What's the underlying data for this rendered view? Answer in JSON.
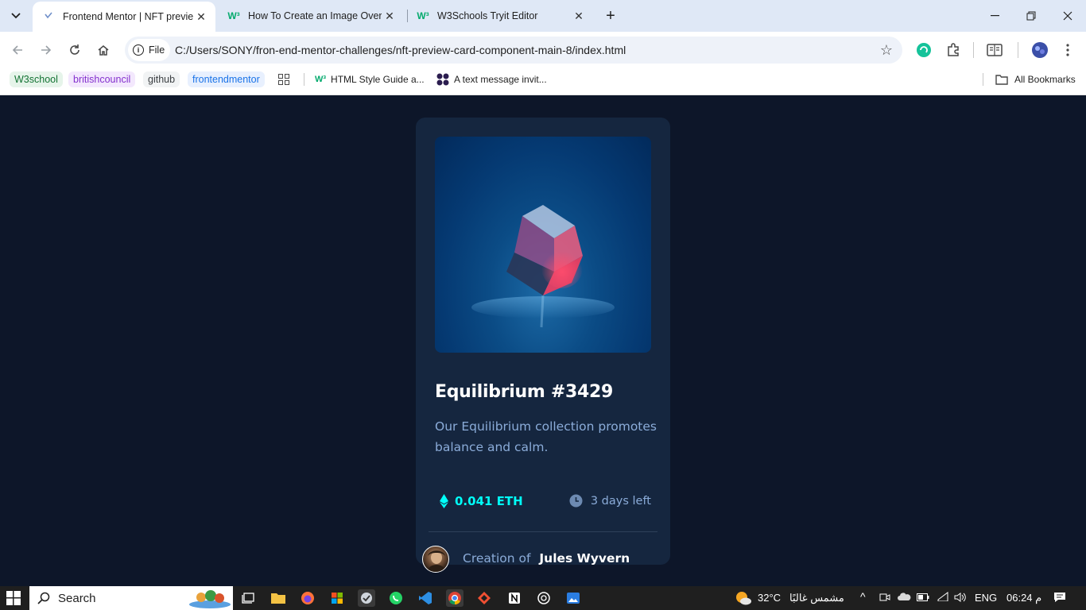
{
  "browser": {
    "tabs": [
      {
        "title": "Frontend Mentor | NFT preview",
        "active": true
      },
      {
        "title": "How To Create an Image Overlay",
        "active": false
      },
      {
        "title": "W3Schools Tryit Editor",
        "active": false
      }
    ],
    "address": {
      "chip_label": "File",
      "url": "C:/Users/SONY/fron-end-mentor-challenges/nft-preview-card-component-main-8/index.html"
    },
    "bookmarks": {
      "chips": [
        "W3school",
        "britishcouncil",
        "github",
        "frontendmentor"
      ],
      "items": [
        "HTML Style Guide a...",
        "A text message invit..."
      ],
      "all_label": "All Bookmarks"
    }
  },
  "card": {
    "title": "Equilibrium #3429",
    "description": "Our Equilibrium collection promotes balance and calm.",
    "price": "0.041 ETH",
    "time_left": "3 days left",
    "creation_prefix": "Creation of",
    "author": "Jules Wyvern"
  },
  "taskbar": {
    "search_label": "Search",
    "weather": "32°C",
    "weather_text": "مشمس غالبًا",
    "language": "ENG",
    "time": "06:24 م"
  },
  "colors": {
    "page_bg": "#0d1629",
    "card_bg": "#15263f",
    "cyan": "#00fff8",
    "soft_blue": "#8bacd9"
  }
}
